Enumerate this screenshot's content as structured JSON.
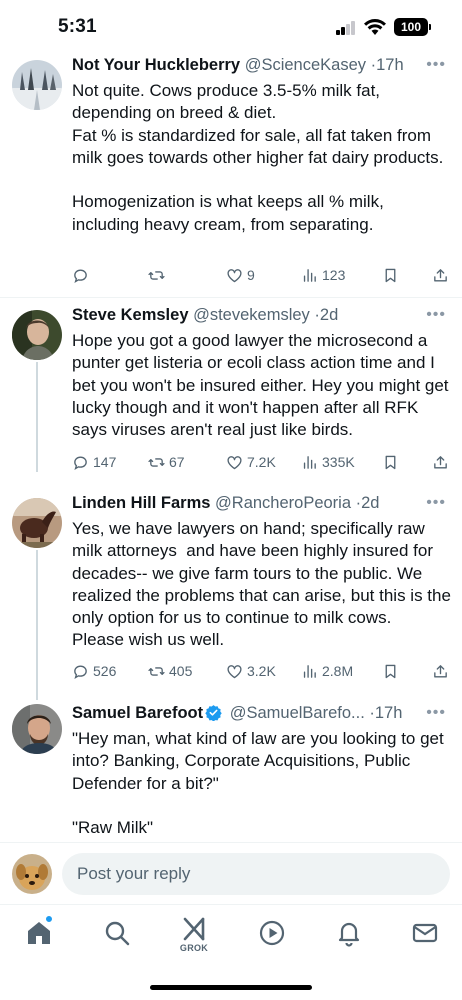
{
  "status_bar": {
    "time": "5:31",
    "battery": "100"
  },
  "posts": [
    {
      "name": "Not Your Huckleberry",
      "handle": "@ScienceKasey",
      "dot": "·",
      "time": "17h",
      "verified": false,
      "text": "Not quite. Cows produce 3.5-5% milk fat, depending on breed & diet.\nFat % is standardized for sale, all fat taken from milk goes towards other higher fat dairy products.\n\nHomogenization is what keeps all % milk, including heavy cream, from separating.",
      "replies": "",
      "reposts": "",
      "likes": "9",
      "views": "123"
    },
    {
      "name": "Steve Kemsley",
      "handle": "@stevekemsley",
      "dot": "·",
      "time": "2d",
      "verified": false,
      "text": "Hope you got a good lawyer the microsecond a punter get listeria or ecoli class action time and I bet you won't be insured either. Hey you might get lucky though and it won't happen after all RFK says viruses aren't real just like birds.",
      "replies": "147",
      "reposts": "67",
      "likes": "7.2K",
      "views": "335K"
    },
    {
      "name": "Linden Hill Farms",
      "handle": "@RancheroPeoria",
      "dot": "·",
      "time": "2d",
      "verified": false,
      "text": "Yes, we have lawyers on hand; specifically raw milk attorneys  and have been highly insured for decades-- we give farm tours to the public. We realized the problems that can arise, but this is the only option for us to continue to milk cows.  Please wish us well.",
      "replies": "526",
      "reposts": "405",
      "likes": "3.2K",
      "views": "2.8M"
    },
    {
      "name": "Samuel Barefoot",
      "handle": "@SamuelBarefo...",
      "dot": "·",
      "time": "17h",
      "verified": true,
      "text": "\"Hey man, what kind of law are you looking to get into? Banking, Corporate Acquisitions, Public Defender for a bit?\"\n\n\"Raw Milk\""
    }
  ],
  "reply_bar": {
    "placeholder": "Post your reply"
  },
  "tabs": {
    "grok_label": "GROK"
  },
  "colors": {
    "accent": "#1d9bf0",
    "text": "#0f1419",
    "muted": "#536471",
    "divider": "#eff3f4"
  },
  "icons": [
    "reply-icon",
    "repost-icon",
    "like-icon",
    "views-icon",
    "bookmark-icon",
    "share-icon",
    "home-icon",
    "search-icon",
    "grok-icon",
    "play-icon",
    "bell-icon",
    "mail-icon"
  ]
}
